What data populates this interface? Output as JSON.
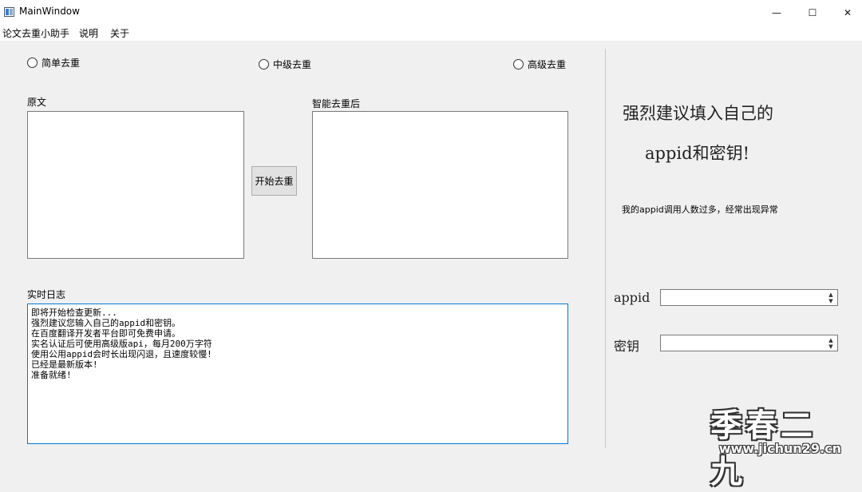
{
  "window": {
    "title": "MainWindow",
    "controls": {
      "minimize": "—",
      "maximize": "☐",
      "close": "✕"
    }
  },
  "menubar": {
    "items": [
      "论文去重小助手",
      "说明",
      "关于"
    ]
  },
  "modes": {
    "options": [
      "简单去重",
      "中级去重",
      "高级去重"
    ],
    "selected": null
  },
  "panels": {
    "original_label": "原文",
    "original_text": "",
    "result_label": "智能去重后",
    "result_text": "",
    "start_button": "开始去重"
  },
  "log": {
    "label": "实时日志",
    "lines": [
      "即将开始检查更新...",
      "强烈建议您输入自己的appid和密钥。",
      "在百度翻译开发者平台即可免费申请。",
      "实名认证后可使用高级版api，每月200万字符",
      "使用公用appid会时长出现闪退，且速度较慢!",
      "已经是最新版本!",
      "准备就绪!"
    ]
  },
  "side": {
    "note_line1": "强烈建议填入自己的",
    "note_line2": "appid和密钥!",
    "warning": "我的appid调用人数过多，经常出现异常",
    "appid_label": "appid",
    "appid_value": "",
    "key_label": "密钥",
    "key_value": ""
  },
  "watermark": {
    "text": "季春二九",
    "url": "www.jichun29.cn"
  }
}
